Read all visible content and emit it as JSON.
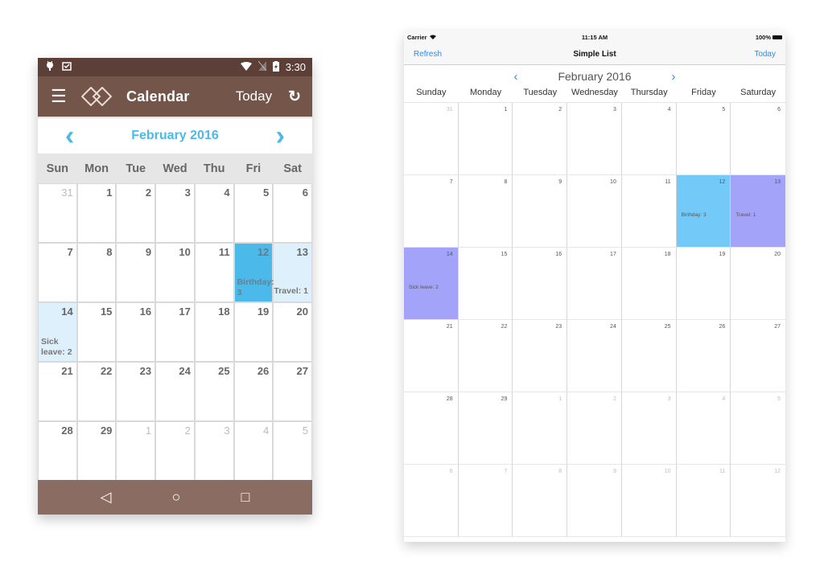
{
  "android": {
    "status_bar": {
      "left_icons": [
        "android-icon",
        "clipboard-check-icon"
      ],
      "right_icons": [
        "wifi-icon",
        "no-sim-icon",
        "battery-charging-icon"
      ],
      "time": "3:30"
    },
    "toolbar": {
      "menu_icon": "hamburger-menu-icon",
      "logo_icon": "interlocked-diamonds-logo",
      "title": "Calendar",
      "today_label": "Today",
      "refresh_icon": "refresh-icon"
    },
    "month_nav": {
      "prev_icon": "‹",
      "month_label": "February 2016",
      "next_icon": "›"
    },
    "weekdays": [
      "Sun",
      "Mon",
      "Tue",
      "Wed",
      "Thu",
      "Fri",
      "Sat"
    ],
    "cells": [
      {
        "day": "31",
        "other": true
      },
      {
        "day": "1"
      },
      {
        "day": "2"
      },
      {
        "day": "3"
      },
      {
        "day": "4"
      },
      {
        "day": "5"
      },
      {
        "day": "6"
      },
      {
        "day": "7"
      },
      {
        "day": "8"
      },
      {
        "day": "9"
      },
      {
        "day": "10"
      },
      {
        "day": "11"
      },
      {
        "day": "12",
        "event": "Birthday: 3",
        "style": "hl-strong"
      },
      {
        "day": "13",
        "event": "Travel: 1",
        "style": "hl-light travel"
      },
      {
        "day": "14",
        "event": "Sick leave: 2",
        "style": "hl-light"
      },
      {
        "day": "15"
      },
      {
        "day": "16"
      },
      {
        "day": "17"
      },
      {
        "day": "18"
      },
      {
        "day": "19"
      },
      {
        "day": "20"
      },
      {
        "day": "21"
      },
      {
        "day": "22"
      },
      {
        "day": "23"
      },
      {
        "day": "24"
      },
      {
        "day": "25"
      },
      {
        "day": "26"
      },
      {
        "day": "27"
      },
      {
        "day": "28"
      },
      {
        "day": "29"
      },
      {
        "day": "1",
        "other": true
      },
      {
        "day": "2",
        "other": true
      },
      {
        "day": "3",
        "other": true
      },
      {
        "day": "4",
        "other": true
      },
      {
        "day": "5",
        "other": true
      }
    ],
    "nav_bar": {
      "back": "◁",
      "home": "○",
      "recents": "□"
    },
    "colors": {
      "status_bar": "#5c3f36",
      "toolbar": "#73554a",
      "nav_bar": "#8b6c62",
      "accent": "#4bb9ea",
      "highlight_light": "#ddf0fb"
    }
  },
  "ios": {
    "status_bar": {
      "carrier": "Carrier",
      "wifi_icon": "wifi-icon",
      "time": "11:15 AM",
      "battery": "100%"
    },
    "navbar": {
      "left_button": "Refresh",
      "title": "Simple List",
      "right_button": "Today"
    },
    "month_nav": {
      "prev_icon": "‹",
      "month_label": "February 2016",
      "next_icon": "›"
    },
    "weekdays": [
      "Sunday",
      "Monday",
      "Tuesday",
      "Wednesday",
      "Thursday",
      "Friday",
      "Saturday"
    ],
    "cells": [
      {
        "day": "31",
        "other": true
      },
      {
        "day": "1"
      },
      {
        "day": "2"
      },
      {
        "day": "3"
      },
      {
        "day": "4"
      },
      {
        "day": "5"
      },
      {
        "day": "6"
      },
      {
        "day": "7"
      },
      {
        "day": "8"
      },
      {
        "day": "9"
      },
      {
        "day": "10"
      },
      {
        "day": "11"
      },
      {
        "day": "12",
        "event": "Birthday: 3",
        "style": "birthday"
      },
      {
        "day": "13",
        "event": "Travel: 1",
        "style": "purple"
      },
      {
        "day": "14",
        "event": "Sick leave: 2",
        "style": "purple"
      },
      {
        "day": "15"
      },
      {
        "day": "16"
      },
      {
        "day": "17"
      },
      {
        "day": "18"
      },
      {
        "day": "19"
      },
      {
        "day": "20"
      },
      {
        "day": "21"
      },
      {
        "day": "22"
      },
      {
        "day": "23"
      },
      {
        "day": "24"
      },
      {
        "day": "25"
      },
      {
        "day": "26"
      },
      {
        "day": "27"
      },
      {
        "day": "28"
      },
      {
        "day": "29"
      },
      {
        "day": "1",
        "other": true
      },
      {
        "day": "2",
        "other": true
      },
      {
        "day": "3",
        "other": true
      },
      {
        "day": "4",
        "other": true
      },
      {
        "day": "5",
        "other": true
      },
      {
        "day": "6",
        "other": true
      },
      {
        "day": "7",
        "other": true
      },
      {
        "day": "8",
        "other": true
      },
      {
        "day": "9",
        "other": true
      },
      {
        "day": "10",
        "other": true
      },
      {
        "day": "11",
        "other": true
      },
      {
        "day": "12",
        "other": true
      }
    ],
    "colors": {
      "tint": "#2f8ce6",
      "birthday": "#73caf9",
      "travel_sick": "#a3a3f9"
    }
  }
}
